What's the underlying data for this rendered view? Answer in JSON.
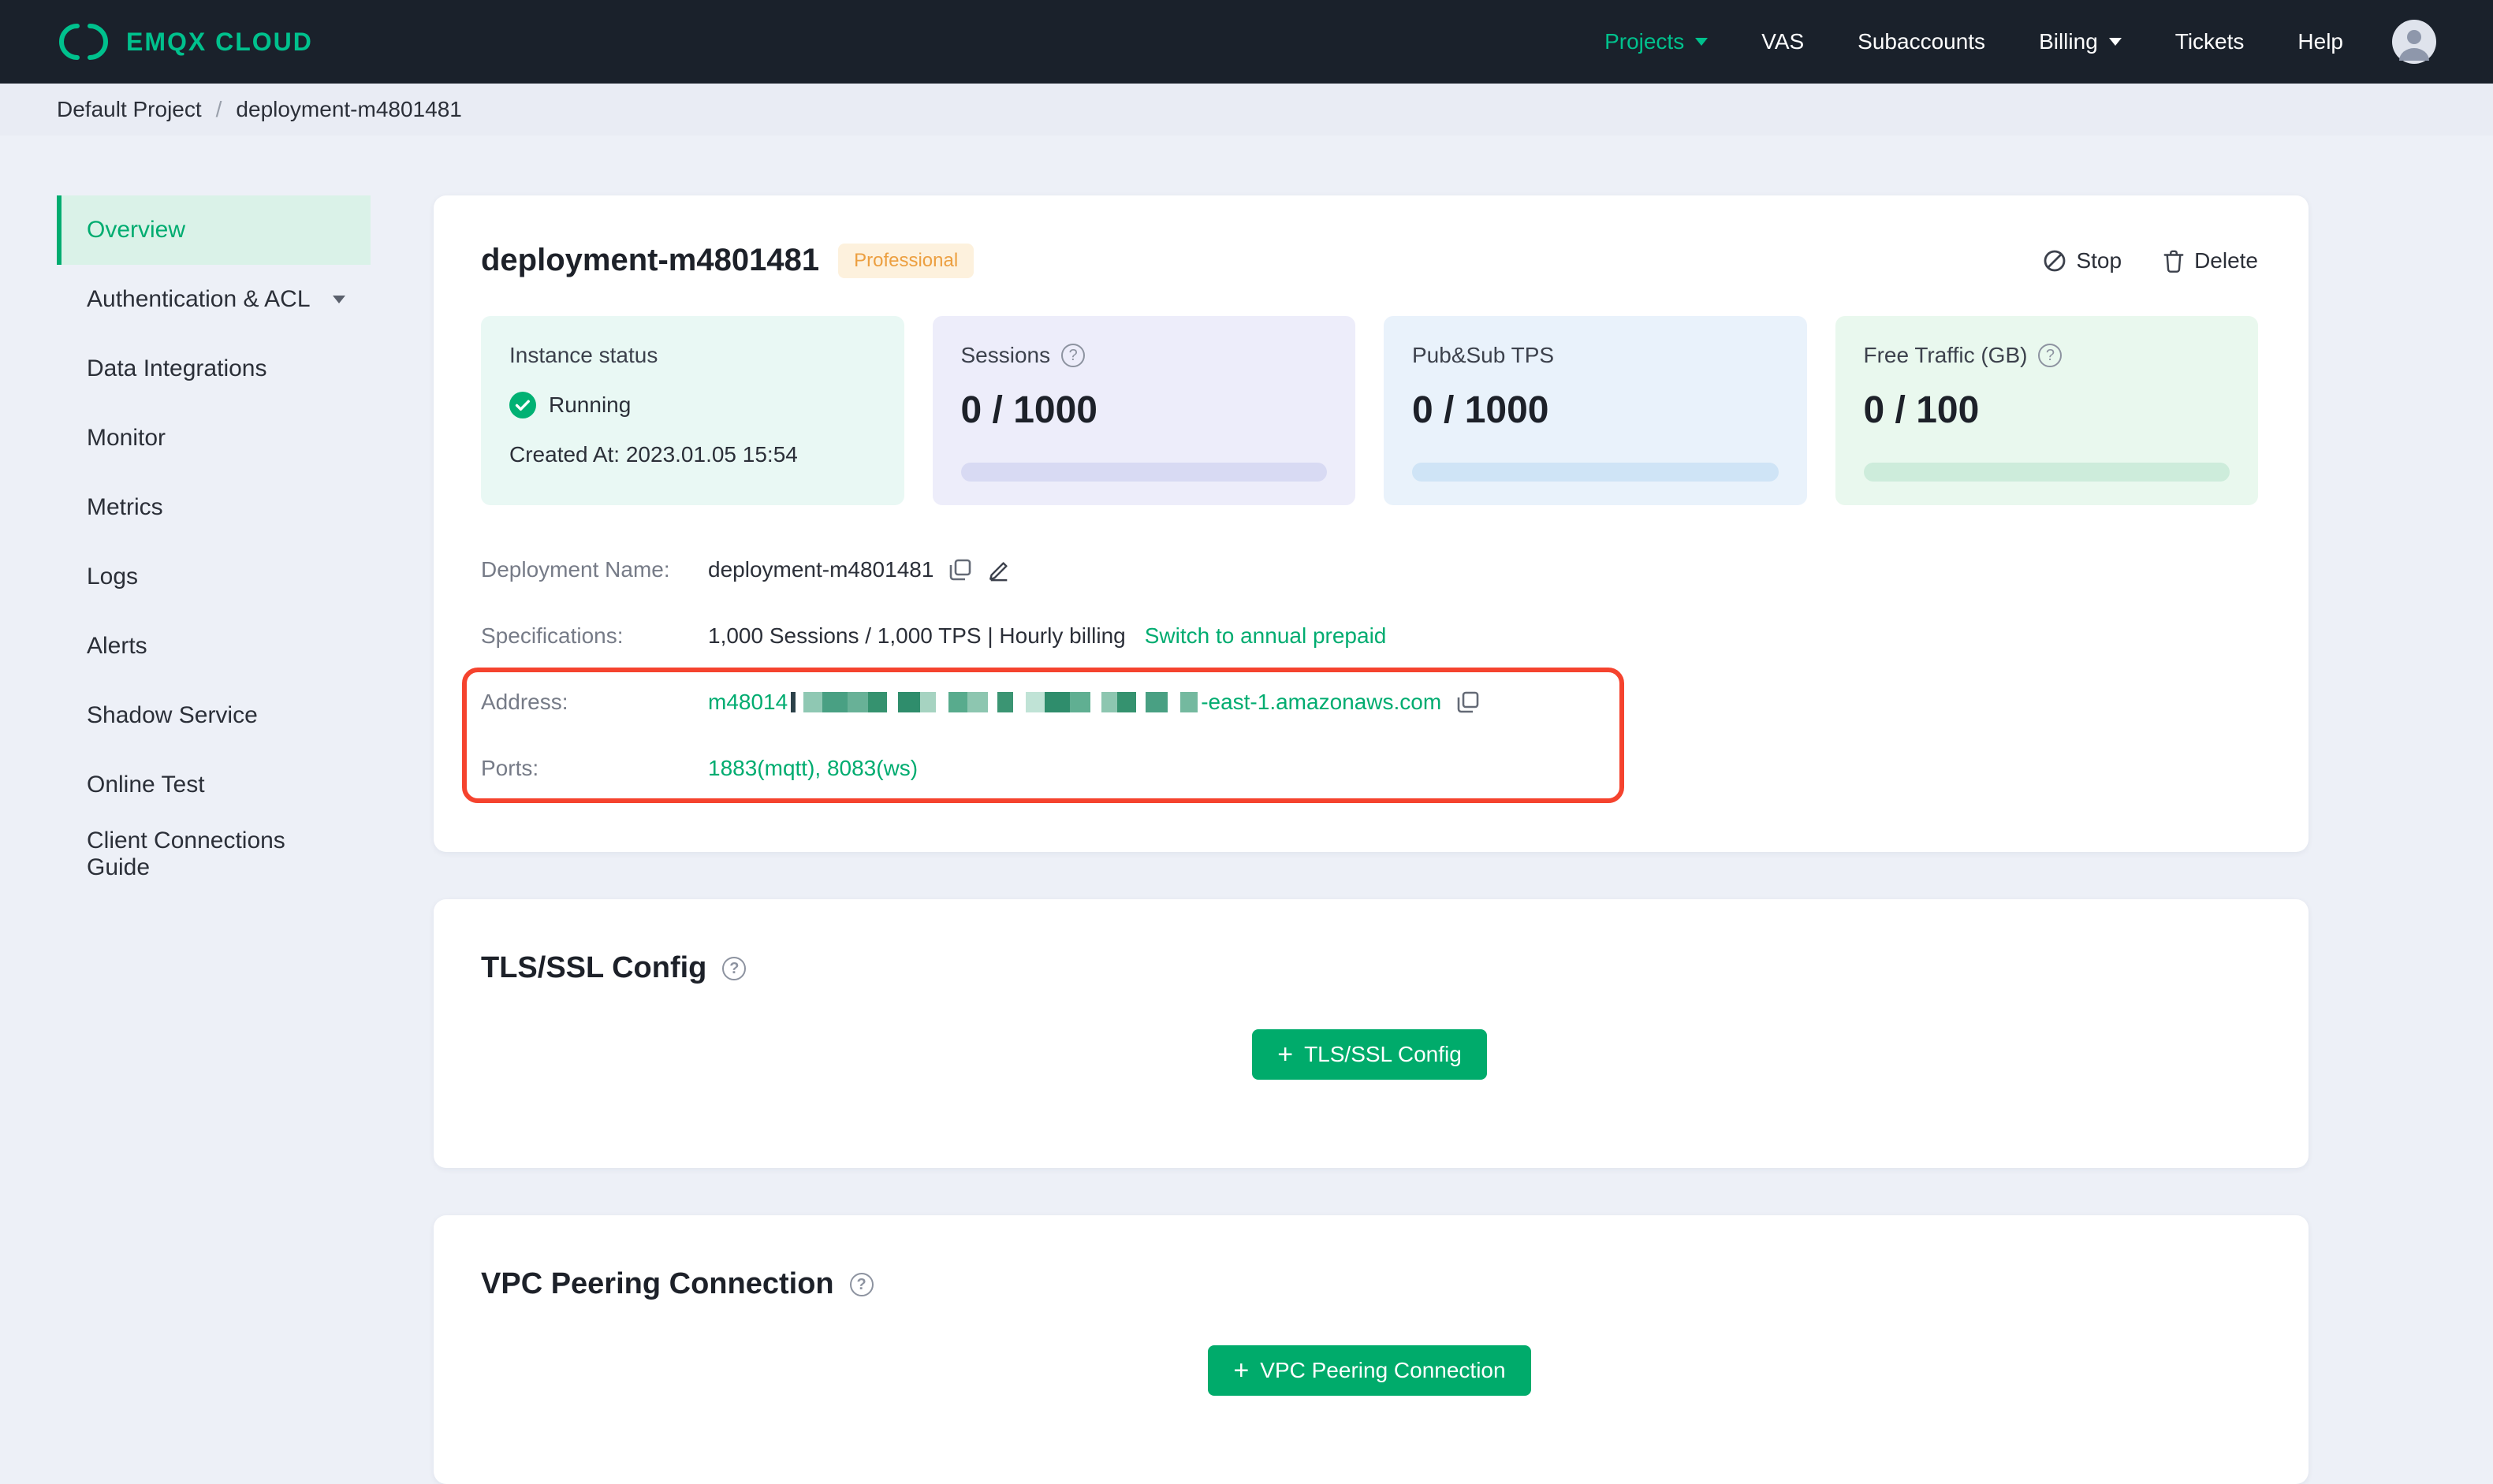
{
  "brand": "EMQX CLOUD",
  "nav": {
    "projects": "Projects",
    "vas": "VAS",
    "subaccounts": "Subaccounts",
    "billing": "Billing",
    "tickets": "Tickets",
    "help": "Help"
  },
  "breadcrumb": {
    "project": "Default Project",
    "separator": "/",
    "current": "deployment-m4801481"
  },
  "sidebar": {
    "items": [
      {
        "label": "Overview"
      },
      {
        "label": "Authentication & ACL"
      },
      {
        "label": "Data Integrations"
      },
      {
        "label": "Monitor"
      },
      {
        "label": "Metrics"
      },
      {
        "label": "Logs"
      },
      {
        "label": "Alerts"
      },
      {
        "label": "Shadow Service"
      },
      {
        "label": "Online Test"
      },
      {
        "label": "Client Connections Guide"
      }
    ]
  },
  "deployment": {
    "title": "deployment-m4801481",
    "badge": "Professional",
    "stop": "Stop",
    "delete": "Delete",
    "stats": {
      "instance": {
        "label": "Instance status",
        "status": "Running",
        "created": "Created At: 2023.01.05 15:54"
      },
      "sessions": {
        "label": "Sessions",
        "value": "0 / 1000"
      },
      "tps": {
        "label": "Pub&Sub TPS",
        "value": "0 / 1000"
      },
      "traffic": {
        "label": "Free Traffic (GB)",
        "value": "0 / 100"
      }
    },
    "info": {
      "name_label": "Deployment Name:",
      "name_value": "deployment-m4801481",
      "spec_label": "Specifications:",
      "spec_value": "1,000 Sessions / 1,000 TPS | Hourly billing",
      "spec_link": "Switch to annual prepaid",
      "address_label": "Address:",
      "address_prefix": "m48014",
      "address_suffix": "-east-1.amazonaws.com",
      "ports_label": "Ports:",
      "ports_value": "1883(mqtt), 8083(ws)"
    }
  },
  "tls": {
    "title": "TLS/SSL Config",
    "button": "TLS/SSL Config"
  },
  "vpc": {
    "title": "VPC Peering Connection",
    "button": "VPC Peering Connection"
  },
  "colors": {
    "accent_green": "#00ac70",
    "brand_green": "#00c18d",
    "badge_orange": "#ec9f40",
    "annotation_red": "#f5432e",
    "topnav_bg": "#1a212b"
  }
}
